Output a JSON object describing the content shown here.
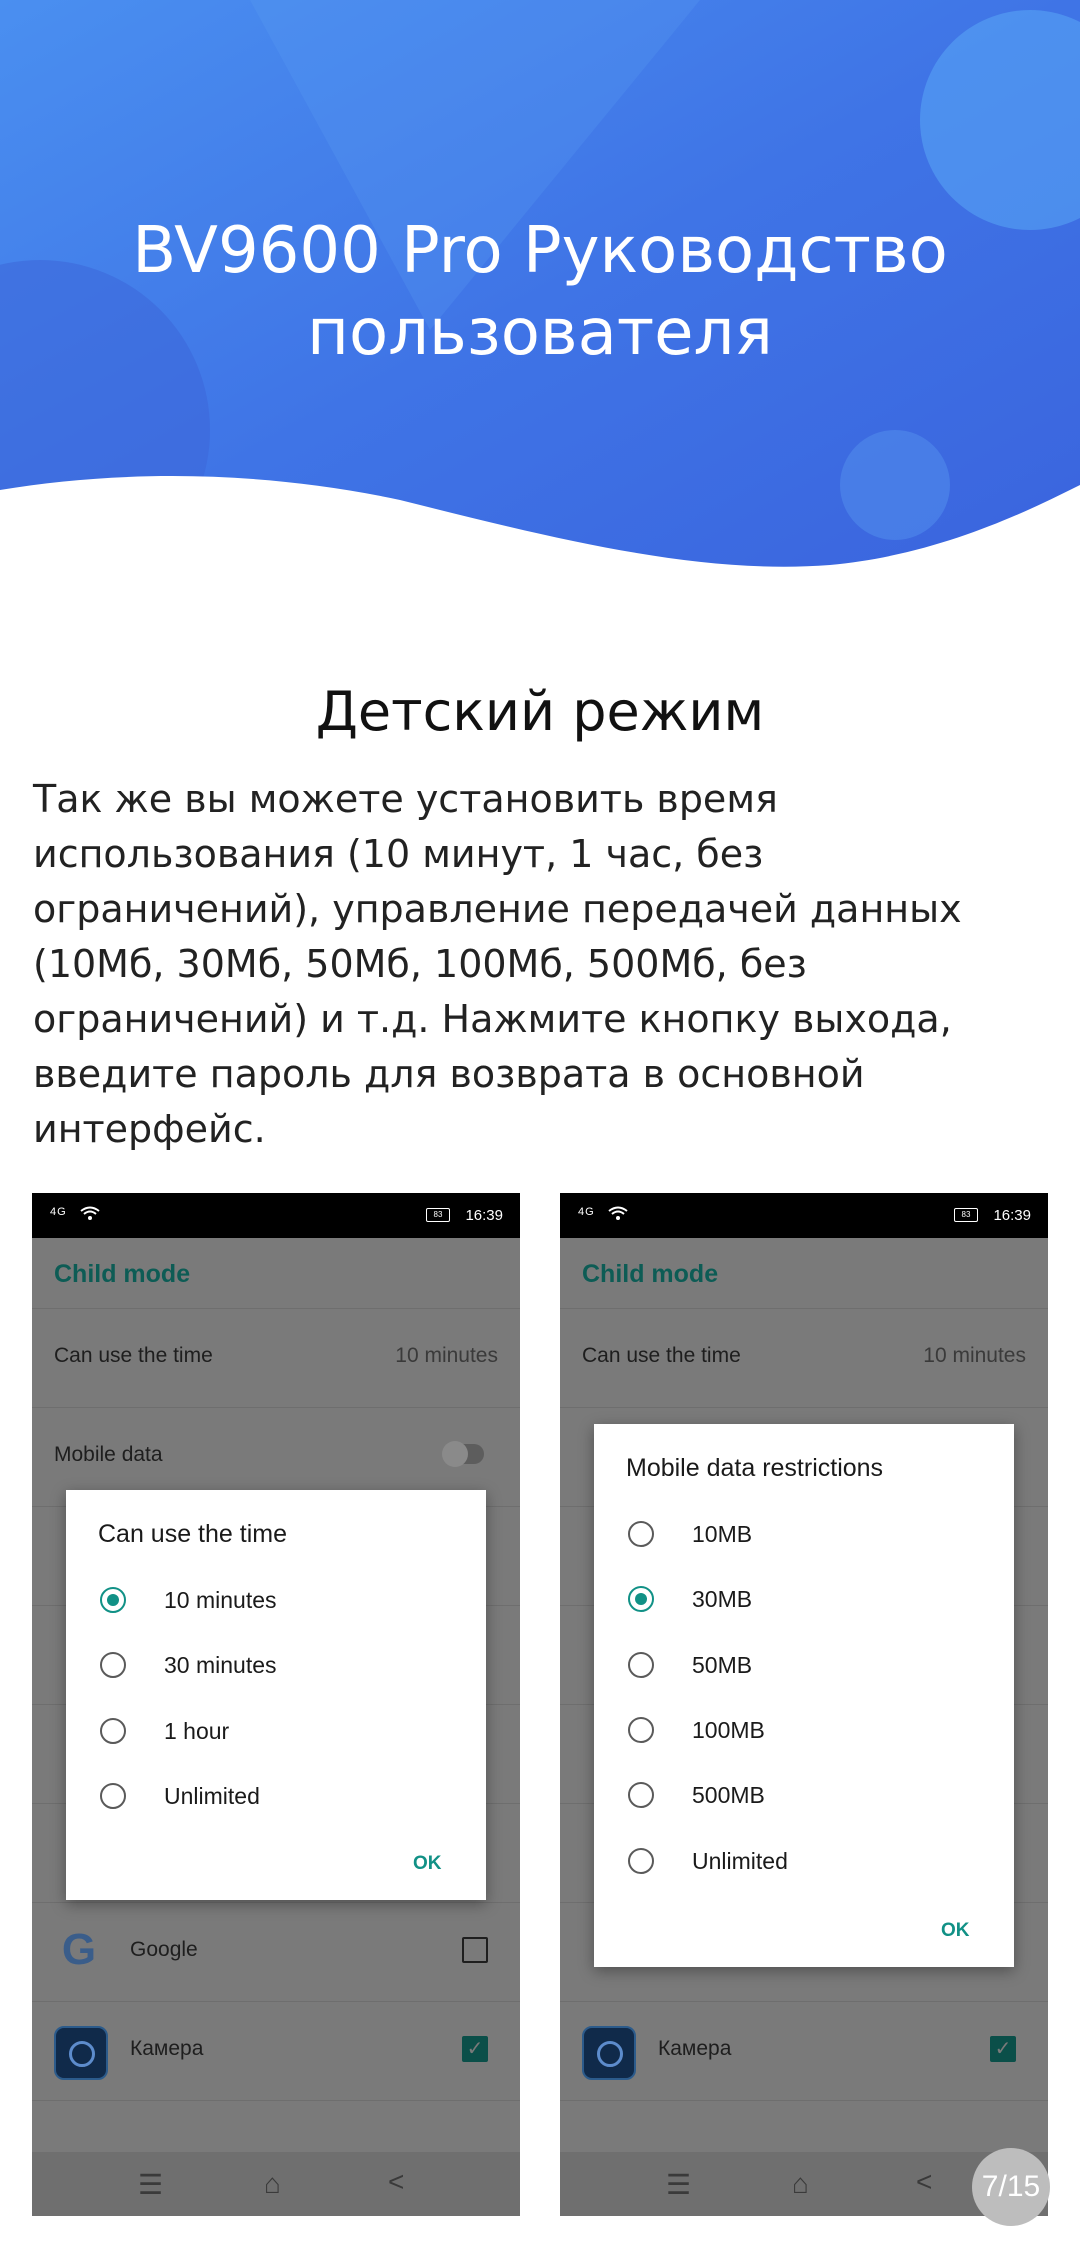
{
  "header": {
    "title": "BV9600 Pro Руководство пользователя"
  },
  "section": {
    "title": "Детский режим",
    "body": "Так же вы можете установить время использования (10 минут, 1 час, без ограничений), управление передачей данных (10Мб, 30Мб, 50Мб, 100Мб, 500Мб, без ограничений) и т.д. Нажмите кнопку выхода, введите пароль для возврата в основной интерфейс."
  },
  "left_screen": {
    "status": {
      "network": "4G",
      "battery": "83",
      "time": "16:39"
    },
    "app_title": "Child mode",
    "rows": {
      "time_label": "Can use the time",
      "time_value": "10 minutes",
      "mobile_data": "Mobile data"
    },
    "apps": [
      {
        "name": "Google",
        "checked": false
      },
      {
        "name": "Камера",
        "checked": true
      }
    ],
    "dialog": {
      "title": "Can use the time",
      "options": [
        "10 minutes",
        "30 minutes",
        "1 hour",
        "Unlimited"
      ],
      "selected": "10 minutes",
      "ok": "OK"
    }
  },
  "right_screen": {
    "status": {
      "network": "4G",
      "battery": "83",
      "time": "16:39"
    },
    "app_title": "Child mode",
    "rows": {
      "time_label": "Can use the time",
      "time_value": "10 minutes"
    },
    "apps": [
      {
        "name": "Камера",
        "checked": true
      }
    ],
    "dialog": {
      "title": "Mobile data restrictions",
      "options": [
        "10MB",
        "30MB",
        "50MB",
        "100MB",
        "500MB",
        "Unlimited"
      ],
      "selected": "30MB",
      "ok": "OK"
    }
  },
  "nav": {
    "menu_icon": "menu-icon",
    "home_icon": "home-icon",
    "back_icon": "back-icon"
  },
  "page_indicator": "7/15",
  "colors": {
    "header_blue": "#3f74e6",
    "accent_teal": "#119186",
    "title_teal": "#0d5c55"
  }
}
